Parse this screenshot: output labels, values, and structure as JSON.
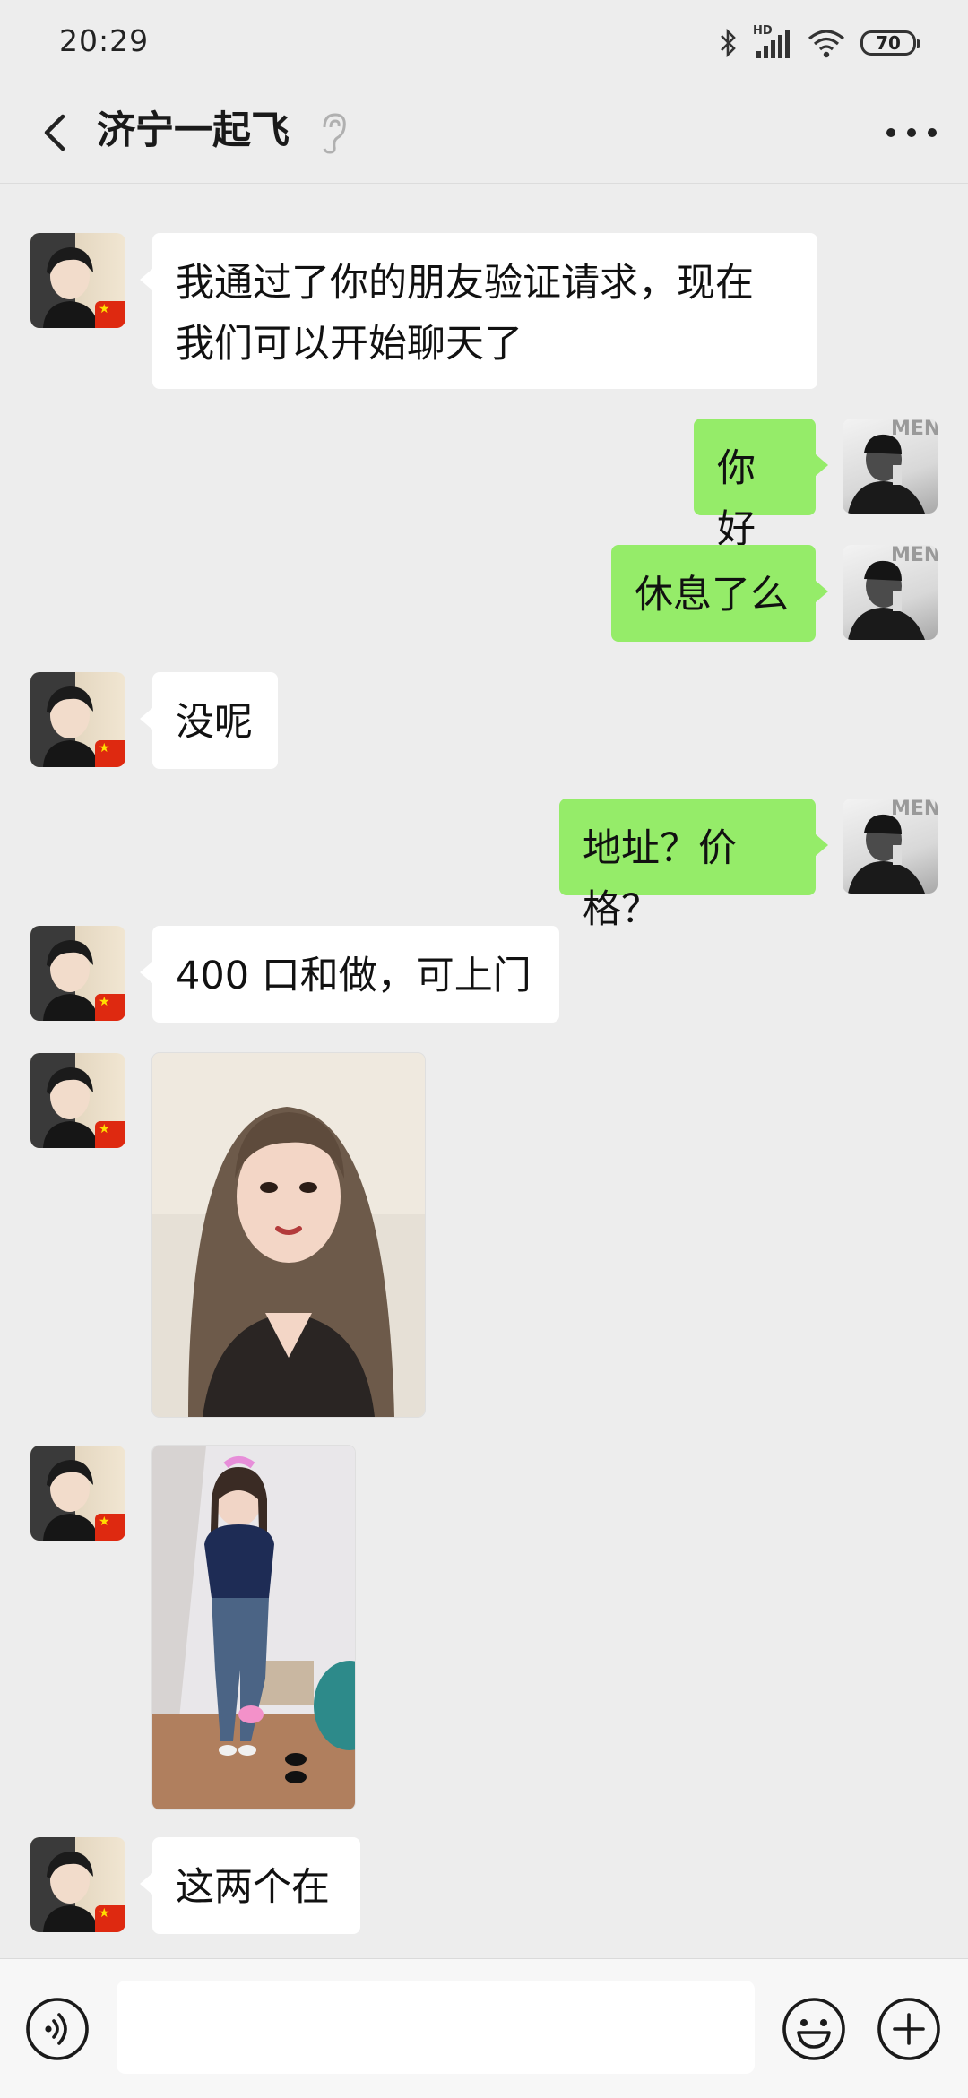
{
  "status_bar": {
    "time": "20:29",
    "battery": "70",
    "network_label": "HD"
  },
  "nav": {
    "title": "济宁一起飞",
    "back_icon": "chevron-left-icon",
    "more_icon": "more-dots-icon",
    "earpiece_icon": "ear-icon"
  },
  "messages": [
    {
      "side": "left",
      "type": "text",
      "text": "我通过了你的朋友验证请求，现在\n我们可以开始聊天了"
    },
    {
      "side": "right",
      "type": "text",
      "text": "你好"
    },
    {
      "side": "right",
      "type": "text",
      "text": "休息了么"
    },
    {
      "side": "left",
      "type": "text",
      "text": "没呢"
    },
    {
      "side": "right",
      "type": "text",
      "text": "地址？价格？"
    },
    {
      "side": "left",
      "type": "text",
      "text": "400 口和做，可上门"
    },
    {
      "side": "left",
      "type": "image",
      "desc_icon": "photo-portrait"
    },
    {
      "side": "left",
      "type": "image",
      "desc_icon": "photo-full-body"
    },
    {
      "side": "left",
      "type": "text",
      "text": "这两个在"
    }
  ],
  "avatar_logo_text": "MEN",
  "input_bar": {
    "placeholder": "",
    "voice_icon": "voice-icon",
    "emoji_icon": "emoji-icon",
    "plus_icon": "plus-icon"
  },
  "colors": {
    "background": "#ededed",
    "self_bubble": "#95ec69",
    "other_bubble": "#ffffff"
  }
}
